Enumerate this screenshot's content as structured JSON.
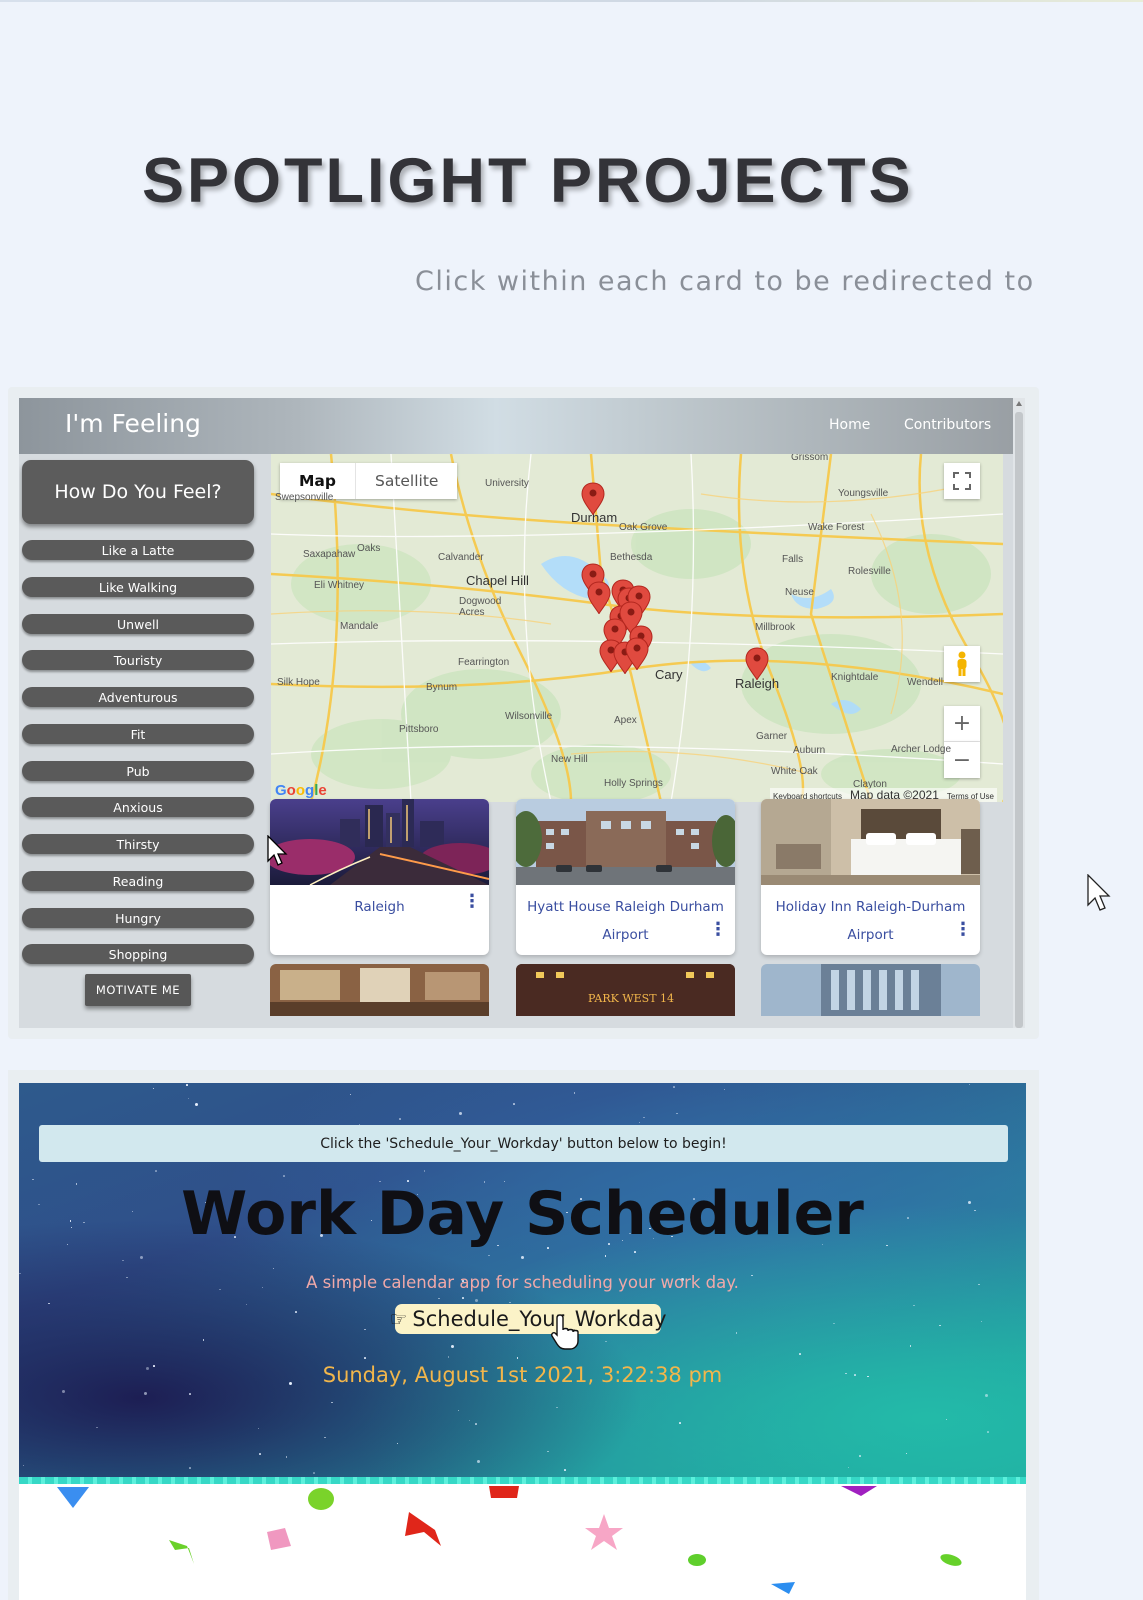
{
  "section": {
    "title": "SPOTLIGHT PROJECTS",
    "subtitle": "Click within each card to be redirected to t"
  },
  "project_feeling": {
    "brand": "I'm Feeling",
    "nav": [
      "Home",
      "Contributors"
    ],
    "feel_button": "How Do You Feel?",
    "moods": [
      "Like a Latte",
      "Like Walking",
      "Unwell",
      "Touristy",
      "Adventurous",
      "Fit",
      "Pub",
      "Anxious",
      "Thirsty",
      "Reading",
      "Hungry",
      "Shopping"
    ],
    "motivate_button": "MOTIVATE ME",
    "map": {
      "type_map": "Map",
      "type_satellite": "Satellite",
      "zoom_in": "+",
      "zoom_out": "−",
      "google": "Google",
      "footer_keyboard": "Keyboard shortcuts",
      "footer_data": "Map data ©2021",
      "footer_terms": "Terms of Use",
      "cities": [
        "Durham",
        "Chapel Hill",
        "Cary",
        "Raleigh"
      ],
      "places": [
        "Grissom",
        "University",
        "Youngsville",
        "Oak Grove",
        "Wake Forest",
        "Bethesda",
        "Saxapahaw",
        "Oaks",
        "Calvander",
        "Falls",
        "Rolesville",
        "Eli Whitney",
        "Dogwood Acres",
        "Neuse",
        "Mandale",
        "Millbrook",
        "Fearrington",
        "Silk Hope",
        "Bynum",
        "Knightdale",
        "Wendell",
        "Pittsboro",
        "Wilsonville",
        "Apex",
        "Garner",
        "Auburn",
        "Archer Lodge",
        "New Hill",
        "White Oak",
        "Holly Springs",
        "Clayton",
        "Swepsonville"
      ]
    },
    "hotels": [
      {
        "name": "Raleigh"
      },
      {
        "name": "Hyatt House Raleigh Durham Airport"
      },
      {
        "name": "Holiday Inn Raleigh-Durham Airport"
      }
    ],
    "thumb_sign": "PARK WEST 14"
  },
  "project_scheduler": {
    "alert": "Click the 'Schedule_Your_Workday' button below to begin!",
    "title": "Work Day Scheduler",
    "subtitle": "A simple calendar app for scheduling your work day.",
    "button_label": "Schedule_Your_Workday",
    "datetime": "Sunday, August 1st 2021, 3:22:38 pm"
  },
  "colors": {
    "background": "#eef3fb",
    "title": "#333338",
    "link_blue": "#3a4ea0",
    "date_orange": "#f2b64b",
    "marker_red": "#e04a3f"
  },
  "icons": [
    "map-pin-icon",
    "fullscreen-icon",
    "pegman-icon",
    "kebab-menu-icon",
    "hand-pointer-icon",
    "arrow-cursor-icon",
    "hand-cursor-icon"
  ]
}
